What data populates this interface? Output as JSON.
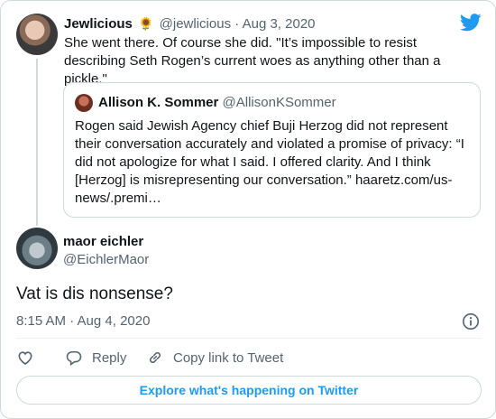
{
  "colors": {
    "accent": "#1d9bf0",
    "text": "#0f1419",
    "muted": "#536471",
    "border": "#cfd9de"
  },
  "parent": {
    "name": "Jewlicious",
    "emoji": "🌻",
    "handle": "@jewlicious",
    "separator": "·",
    "date": "Aug 3, 2020",
    "text": "She went there. Of course she did. \"It’s impossible to resist describing Seth Rogen’s current woes as anything other than a pickle.\""
  },
  "quote": {
    "name": "Allison K. Sommer",
    "handle": "@AllisonKSommer",
    "text": "Rogen said Jewish Agency chief Buji Herzog did not represent their conversation accurately and violated a promise of privacy: “I did not apologize for what I said. I offered clarity. And I think [Herzog] is misrepresenting our conversation.” haaretz.com/us-news/.premi…"
  },
  "tweet": {
    "name": "maor eichler",
    "handle": "@EichlerMaor",
    "text": "Vat is dis nonsense?",
    "time": "8:15 AM · Aug 4, 2020"
  },
  "actions": {
    "reply_label": "Reply",
    "copy_link_label": "Copy link to Tweet"
  },
  "explore_label": "Explore what's happening on Twitter",
  "icons": [
    "twitter-logo-icon",
    "heart-icon",
    "reply-icon",
    "link-icon",
    "info-icon"
  ]
}
